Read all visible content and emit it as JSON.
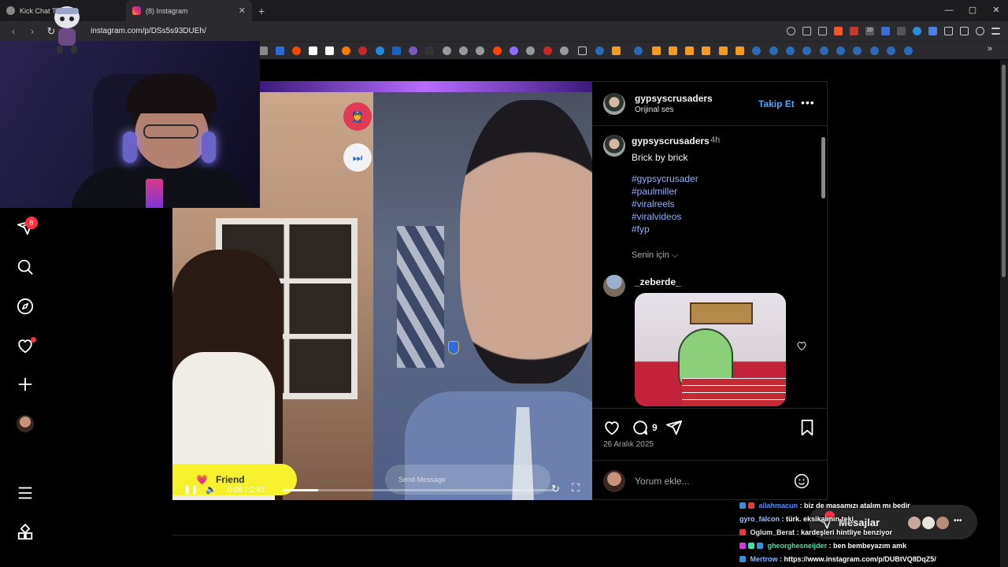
{
  "browser": {
    "tabs": [
      {
        "label": "Kick Chat Takip",
        "active": false
      },
      {
        "label": "(8) Instagram",
        "active": true
      }
    ],
    "url": "instagram.com/p/DSs5s93DUEh/",
    "window_controls": [
      "—",
      "▢",
      "✕"
    ],
    "ext_badge": "20"
  },
  "sidenav": {
    "items": [
      {
        "icon": "send-icon",
        "label": "Mesajlar"
      },
      {
        "icon": "search-icon",
        "label": "Ara"
      },
      {
        "icon": "compass-icon",
        "label": "Keşfet"
      },
      {
        "icon": "heart-icon",
        "label": "Bildirimler"
      },
      {
        "icon": "plus-icon",
        "label": "Oluştur"
      },
      {
        "icon": "avatar",
        "label": "Profil"
      },
      {
        "icon": "menu-icon",
        "label": "Daha fazla"
      },
      {
        "icon": "apps-icon",
        "label": "Ayrıca Meta'dan"
      }
    ],
    "messages_badge": "8"
  },
  "video": {
    "friend_label": "Friend",
    "send_message_placeholder": "Send Message",
    "time": "0:06 / 0:45",
    "progress": 0.13
  },
  "post": {
    "author": "gypsyscrusaders",
    "audio": "Orijinal ses",
    "follow_label": "Takip Et",
    "caption_author": "gypsyscrusaders",
    "caption_time": "4h",
    "caption": "Brick by brick",
    "hashtags": [
      "#gypsycrusader",
      "#paulmiller",
      "#viralreels",
      "#viralvideos",
      "#fyp"
    ],
    "for_you": "Senin için",
    "comment_author": "_zeberde_",
    "comment_count": "9",
    "date": "26 Aralık 2025",
    "add_comment_placeholder": "Yorum ekle..."
  },
  "messages_pill": {
    "label": "Mesajlar"
  },
  "kick_chat": [
    {
      "user": "allahmacun",
      "text": "biz de masamızı atalım mı bedir",
      "color": "#4a90ff"
    },
    {
      "user": "gyro_falcon",
      "text": "türk. eksikalının teki",
      "color": "#9ec1ff"
    },
    {
      "user": "Oglum_Berat",
      "text": "kardeşleri hintliye benziyor",
      "color": "#e8e8e8"
    },
    {
      "user": "gheorghesneijder",
      "text": "ben bembeyazım amk",
      "color": "#3fe0a0"
    },
    {
      "user": "Mertrow",
      "text": "https://www.instagram.com/p/DUBtVQ8DqZ5/",
      "color": "#8fb4ff"
    }
  ]
}
